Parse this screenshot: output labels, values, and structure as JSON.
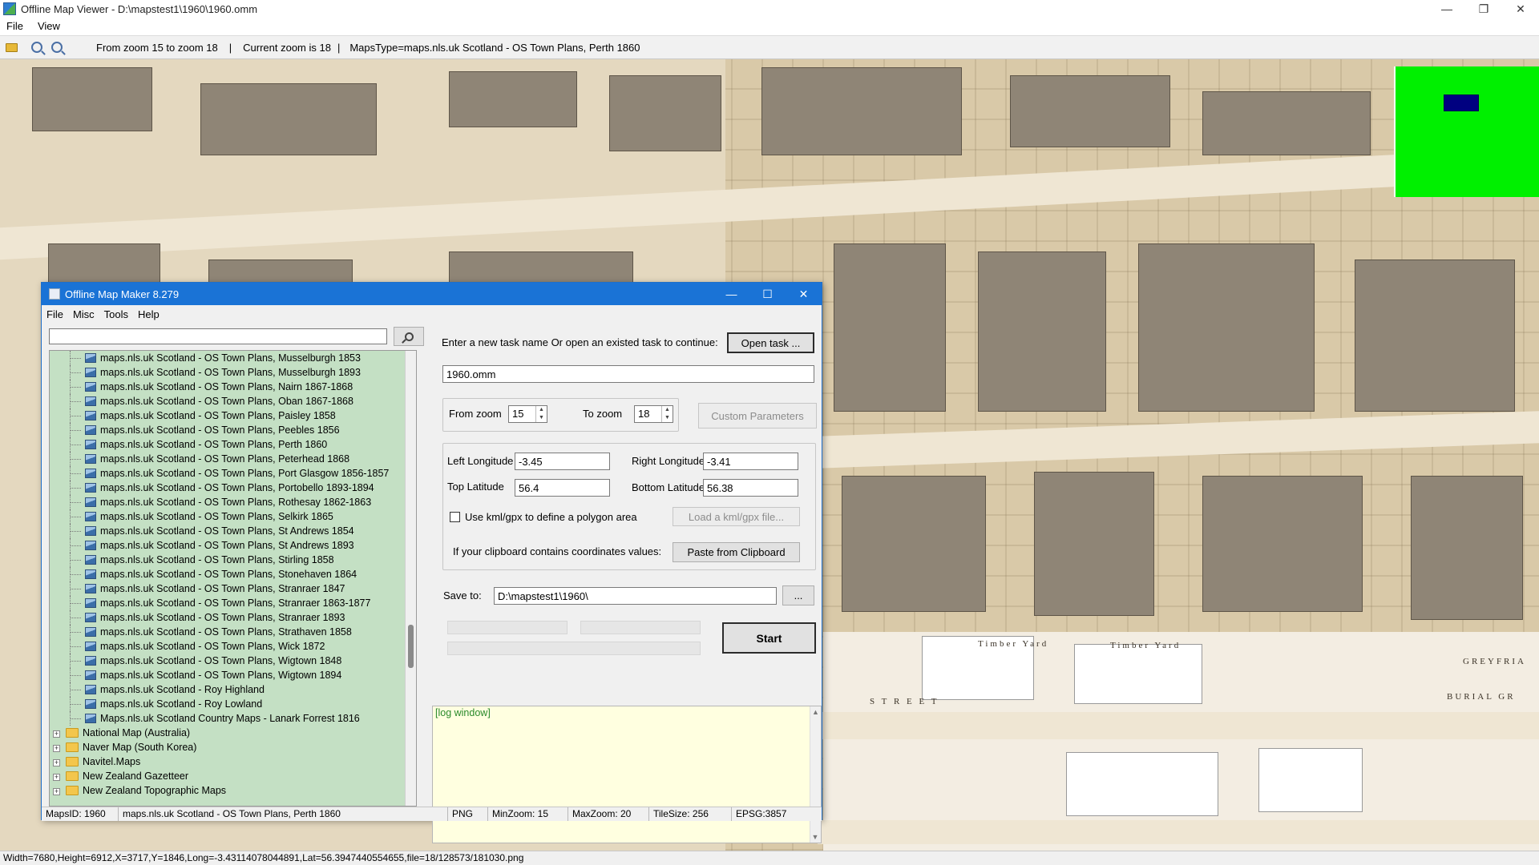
{
  "viewer": {
    "title": "Offline Map Viewer - D:\\mapstest1\\1960\\1960.omm",
    "window_controls": [
      "—",
      "❐",
      "✕"
    ],
    "menu": [
      "File",
      "View"
    ],
    "toolbar": {
      "zoom_range": "From zoom 15 to zoom 18",
      "separator": "|",
      "current_zoom": "Current zoom is 18",
      "maps_type": "MapsType=maps.nls.uk Scotland - OS Town Plans, Perth 1860"
    },
    "status": "Width=7680,Height=6912,X=3717,Y=1846,Long=-3.43114078044891,Lat=56.3947440554655,file=18/128573/181030.png",
    "map_labels": [
      "Timber Yard",
      "Timber Yard",
      "GREYFRIA",
      "BURIAL GR",
      "S T R E E T"
    ]
  },
  "dialog": {
    "title": "Offline Map Maker 8.279",
    "window_controls": [
      "—",
      "☐",
      "✕"
    ],
    "menu": [
      "File",
      "Misc",
      "Tools",
      "Help"
    ],
    "search": {
      "value": "",
      "placeholder": ""
    },
    "tree_children": [
      "maps.nls.uk Scotland - OS Town Plans, Musselburgh 1853",
      "maps.nls.uk Scotland - OS Town Plans, Musselburgh 1893",
      "maps.nls.uk Scotland - OS Town Plans, Nairn 1867-1868",
      "maps.nls.uk Scotland - OS Town Plans, Oban 1867-1868",
      "maps.nls.uk Scotland - OS Town Plans, Paisley 1858",
      "maps.nls.uk Scotland - OS Town Plans, Peebles 1856",
      "maps.nls.uk Scotland - OS Town Plans, Perth 1860",
      "maps.nls.uk Scotland - OS Town Plans, Peterhead 1868",
      "maps.nls.uk Scotland - OS Town Plans, Port Glasgow 1856-1857",
      "maps.nls.uk Scotland - OS Town Plans, Portobello 1893-1894",
      "maps.nls.uk Scotland - OS Town Plans, Rothesay 1862-1863",
      "maps.nls.uk Scotland - OS Town Plans, Selkirk 1865",
      "maps.nls.uk Scotland - OS Town Plans, St Andrews 1854",
      "maps.nls.uk Scotland - OS Town Plans, St Andrews 1893",
      "maps.nls.uk Scotland - OS Town Plans, Stirling 1858",
      "maps.nls.uk Scotland - OS Town Plans, Stonehaven 1864",
      "maps.nls.uk Scotland - OS Town Plans, Stranraer 1847",
      "maps.nls.uk Scotland - OS Town Plans, Stranraer 1863-1877",
      "maps.nls.uk Scotland - OS Town Plans, Stranraer 1893",
      "maps.nls.uk Scotland - OS Town Plans, Strathaven 1858",
      "maps.nls.uk Scotland - OS Town Plans, Wick 1872",
      "maps.nls.uk Scotland - OS Town Plans, Wigtown 1848",
      "maps.nls.uk Scotland - OS Town Plans, Wigtown 1894",
      "maps.nls.uk Scotland - Roy Highland",
      "maps.nls.uk Scotland - Roy Lowland",
      "Maps.nls.uk Scotland Country Maps - Lanark Forrest 1816"
    ],
    "tree_folders": [
      "National Map (Australia)",
      "Naver Map (South Korea)",
      "Navitel.Maps",
      "New Zealand Gazetteer",
      "New Zealand Topographic Maps"
    ],
    "task_prompt": "Enter a new task name Or open an existed task to continue:",
    "open_task_label": "Open task ...",
    "task_name": "1960.omm",
    "from_zoom_label": "From zoom",
    "from_zoom": "15",
    "to_zoom_label": "To zoom",
    "to_zoom": "18",
    "custom_params_label": "Custom Parameters",
    "left_long_label": "Left Longitude",
    "left_long": "-3.45",
    "right_long_label": "Right Longitude",
    "right_long": "-3.41",
    "top_lat_label": "Top Latitude",
    "top_lat": "56.4",
    "bottom_lat_label": "Bottom Latitude",
    "bottom_lat": "56.38",
    "kml_checkbox_label": "Use kml/gpx to define a polygon area",
    "load_kml_label": "Load a kml/gpx file...",
    "clipboard_prompt": "If your clipboard contains coordinates values:",
    "paste_label": "Paste from Clipboard",
    "save_to_label": "Save to:",
    "save_to": "D:\\mapstest1\\1960\\",
    "browse_label": "...",
    "start_label": "Start",
    "log_text": "[log window]",
    "status": {
      "maps_id": "MapsID: 1960",
      "maps_name": "maps.nls.uk Scotland - OS Town Plans, Perth 1860",
      "format": "PNG",
      "min_zoom": "MinZoom: 15",
      "max_zoom": "MaxZoom: 20",
      "tile_size": "TileSize: 256",
      "epsg": "EPSG:3857"
    }
  },
  "colors": {
    "tree_bg": "#c4e0c4",
    "log_bg": "#ffffe0",
    "dialog_title": "#1a73d6",
    "overview_bg": "#00f000",
    "overview_rect": "#000080"
  }
}
